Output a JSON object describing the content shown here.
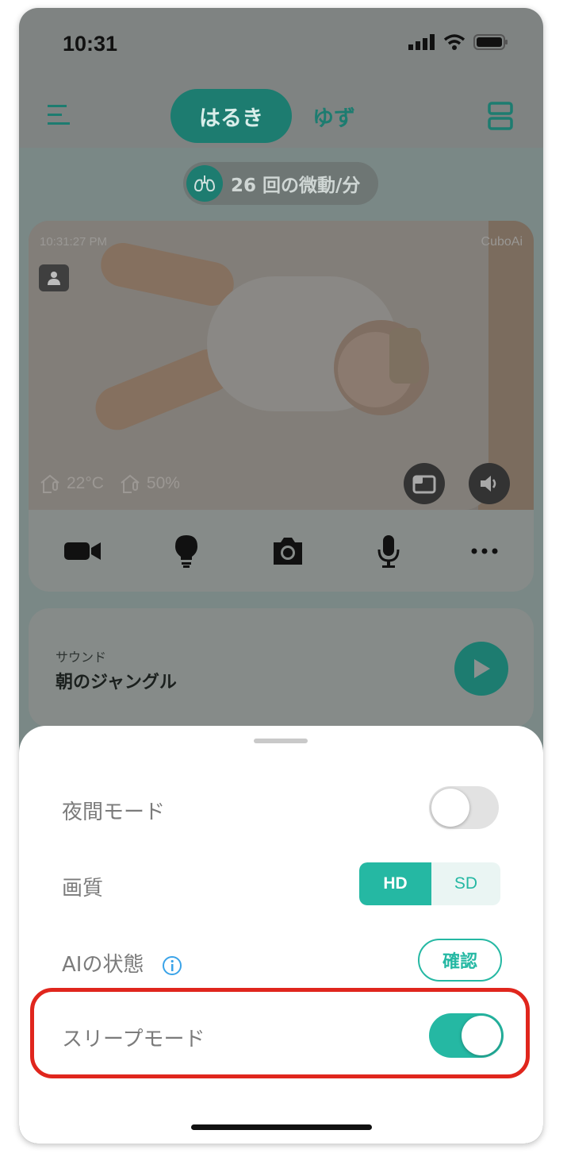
{
  "status_bar": {
    "time": "10:31"
  },
  "header": {
    "tabs": [
      {
        "label": "はるき",
        "active": true
      },
      {
        "label": "ゆず",
        "active": false
      }
    ]
  },
  "breathing": {
    "text": "26 回の微動/分"
  },
  "camera": {
    "timestamp": "10:31:27 PM",
    "brand": "CuboAi",
    "temperature": "22°C",
    "humidity": "50%"
  },
  "sound": {
    "label": "サウンド",
    "name": "朝のジャングル"
  },
  "sheet": {
    "night_mode": {
      "label": "夜間モード",
      "on": false
    },
    "quality": {
      "label": "画質",
      "options": [
        "HD",
        "SD"
      ],
      "selected": "HD"
    },
    "ai_status": {
      "label": "AIの状態",
      "button": "確認"
    },
    "sleep_mode": {
      "label": "スリープモード",
      "on": true
    }
  },
  "colors": {
    "accent": "#25b8a3",
    "dark_accent": "#1d7c70",
    "highlight": "#e0261d"
  }
}
